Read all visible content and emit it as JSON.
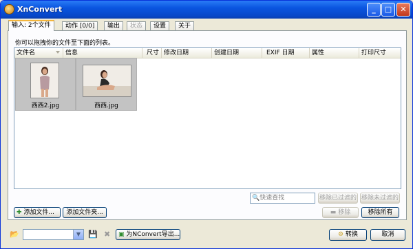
{
  "window": {
    "title": "XnConvert",
    "min_glyph": "_",
    "max_glyph": "□",
    "close_glyph": "✕"
  },
  "tabs": [
    {
      "label": "输入: 2个文件",
      "active": true
    },
    {
      "label": "动作 [0/0]"
    },
    {
      "label": "输出"
    },
    {
      "label": "状态",
      "disabled": true
    },
    {
      "label": "设置"
    },
    {
      "label": "关于"
    }
  ],
  "input_panel": {
    "hint": "你可以拖拽你的文件至下面的列表。",
    "columns": [
      "文件名",
      "信息",
      "尺寸",
      "修改日期",
      "创建日期",
      "EXIF 日期",
      "属性",
      "打印尺寸"
    ],
    "files": [
      {
        "name": "西西2.jpg"
      },
      {
        "name": "西西.jpg"
      }
    ],
    "search_placeholder": "快速查找",
    "remove_filtered": "移除已过滤的",
    "remove_unfiltered": "移除未过滤的",
    "add_files": "添加文件...",
    "add_folder": "添加文件夹...",
    "remove": "移除",
    "remove_all": "移除所有"
  },
  "footer": {
    "export": "为NConvert导出...",
    "convert": "转换",
    "cancel": "取消"
  },
  "colors": {
    "titlebar": "#0a55e0",
    "panel_bg": "#fcfcfe",
    "active_tab_accent": "#f3b53c"
  }
}
